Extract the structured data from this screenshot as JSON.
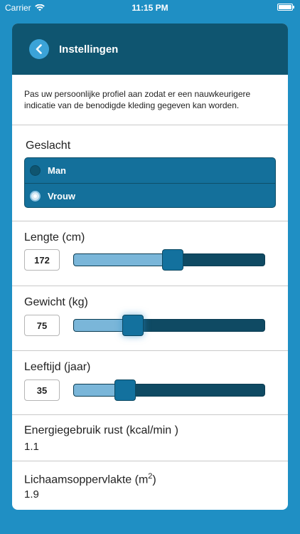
{
  "status_bar": {
    "carrier": "Carrier",
    "time": "11:15 PM"
  },
  "header": {
    "title": "Instellingen"
  },
  "intro_text": "Pas uw persoonlijke profiel aan zodat er een nauwkeurigere indicatie van de benodigde kleding gegeven kan worden.",
  "gender": {
    "label": "Geslacht",
    "options": [
      {
        "label": "Man",
        "selected": false
      },
      {
        "label": "Vrouw",
        "selected": true
      }
    ]
  },
  "sliders": [
    {
      "label": "Lengte (cm)",
      "value": "172",
      "fraction": 0.52
    },
    {
      "label": "Gewicht (kg)",
      "value": "75",
      "fraction": 0.31
    },
    {
      "label": "Leeftijd (jaar)",
      "value": "35",
      "fraction": 0.27
    }
  ],
  "energy": {
    "label": "Energiegebruik rust (kcal/min )",
    "value": "1.1"
  },
  "body_surface": {
    "label_prefix": "Lichaamsoppervlakte (m",
    "label_sup": "2",
    "label_suffix": ")",
    "value": "1.9"
  },
  "colors": {
    "background": "#1f8fc4",
    "header": "#0f5570",
    "accent": "#13719e",
    "track_fill": "#7ab6d9"
  }
}
